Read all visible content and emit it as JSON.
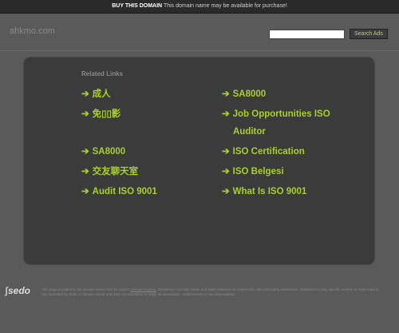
{
  "topbar": {
    "buy_label": "BUY THIS DOMAIN",
    "message": "This domain name may be available for purchase!"
  },
  "header": {
    "domain": "ahkmo.com",
    "search_button": "Search Ads"
  },
  "related": {
    "title": "Related Links",
    "left": [
      {
        "label": "成人"
      },
      {
        "label": "免▯▯影"
      },
      {
        "label": "SA8000"
      },
      {
        "label": "交友聊天室"
      },
      {
        "label": "Audit ISO 9001"
      }
    ],
    "right": [
      {
        "label": "SA8000"
      },
      {
        "label": "Job Opportunities ISO",
        "label2": "Auditor"
      },
      {
        "label": "ISO Certification"
      },
      {
        "label": "ISO Belgesi"
      },
      {
        "label": "What Is ISO 9001"
      }
    ]
  },
  "footer": {
    "logo_text": "sedo",
    "text_part1": "This page provided to the domain owner free by Sedo's",
    "link1": "Domain Parking",
    "text_part2": ". Disclaimer: Domain owner and Sedo maintain no relationship with third party advertisers. Reference to any specific service or trade mark is not controlled by Sedo or domain owner and does not constitute or imply its association, endorsement or recommendation."
  },
  "colors": {
    "background": "#5a5a5a",
    "panel": "#3b3b3b",
    "link": "#a9cf2b",
    "topbar": "#2a2a2a"
  }
}
